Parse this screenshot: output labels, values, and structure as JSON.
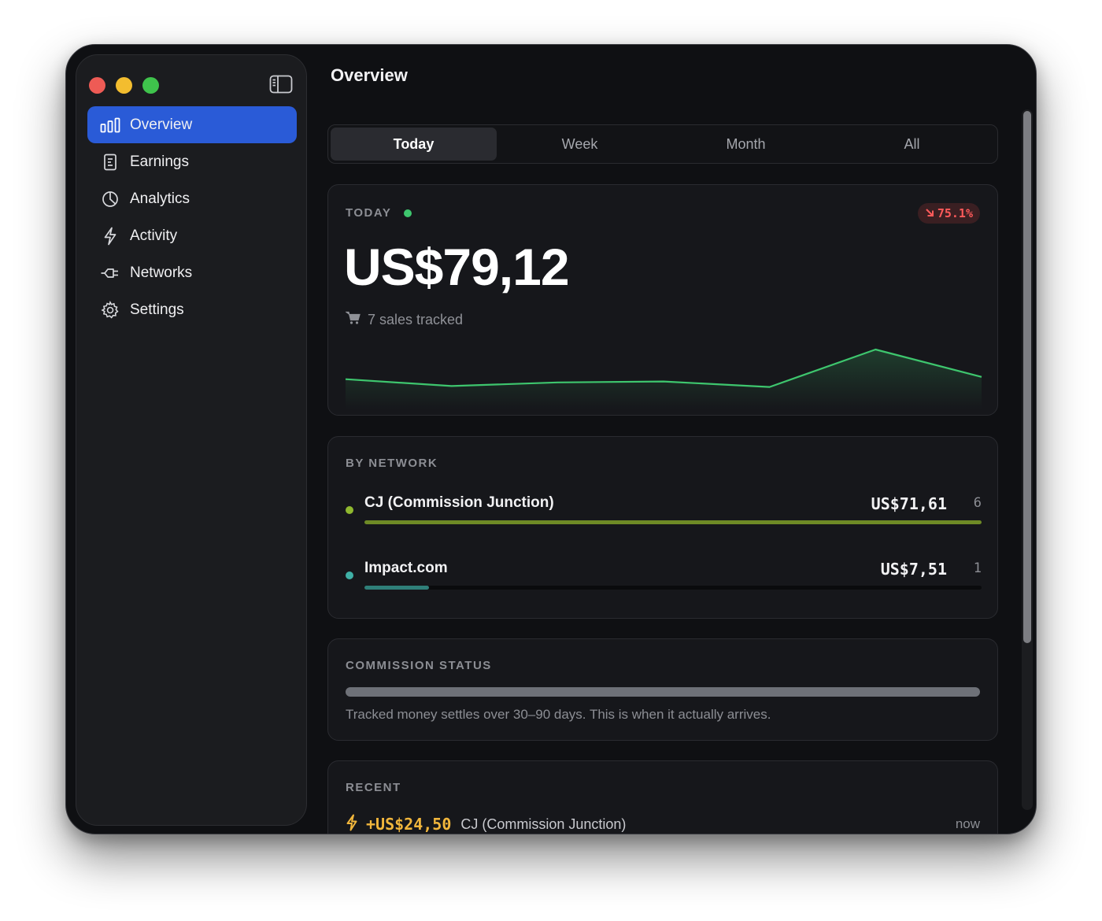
{
  "window": {
    "title": "Overview"
  },
  "sidebar": {
    "items": [
      {
        "label": "Overview",
        "icon": "bar-chart-icon",
        "active": true
      },
      {
        "label": "Earnings",
        "icon": "receipt-icon",
        "active": false
      },
      {
        "label": "Analytics",
        "icon": "pie-chart-icon",
        "active": false
      },
      {
        "label": "Activity",
        "icon": "bolt-icon",
        "active": false
      },
      {
        "label": "Networks",
        "icon": "plug-icon",
        "active": false
      },
      {
        "label": "Settings",
        "icon": "gear-icon",
        "active": false
      }
    ]
  },
  "tabs": [
    {
      "label": "Today",
      "active": true
    },
    {
      "label": "Week",
      "active": false
    },
    {
      "label": "Month",
      "active": false
    },
    {
      "label": "All",
      "active": false
    }
  ],
  "today": {
    "label": "TODAY",
    "change": "75.1%",
    "change_direction": "down",
    "amount": "US$79,12",
    "sales": "7 sales tracked",
    "sparkline": [
      0.35,
      0.2,
      0.28,
      0.3,
      0.18,
      1.0,
      0.4
    ]
  },
  "by_network": {
    "label": "BY NETWORK",
    "rows": [
      {
        "name": "CJ (Commission Junction)",
        "amount": "US$71,61",
        "count": "6",
        "share": 1.0,
        "color": "#8fb82f",
        "bar_color": "#6e8a26"
      },
      {
        "name": "Impact.com",
        "amount": "US$7,51",
        "count": "1",
        "share": 0.105,
        "color": "#3fb0a6",
        "bar_color": "#2f7f79"
      }
    ]
  },
  "commission_status": {
    "label": "COMMISSION STATUS",
    "note": "Tracked money settles over 30–90 days. This is when it actually arrives."
  },
  "recent": {
    "label": "RECENT",
    "items": [
      {
        "amount": "+US$24,50",
        "network": "CJ (Commission Junction)",
        "time": "now"
      }
    ]
  },
  "colors": {
    "accent": "#2a5bd7",
    "positive": "#3ec66e",
    "negative": "#ff5a5a",
    "highlight": "#f1b63c"
  }
}
